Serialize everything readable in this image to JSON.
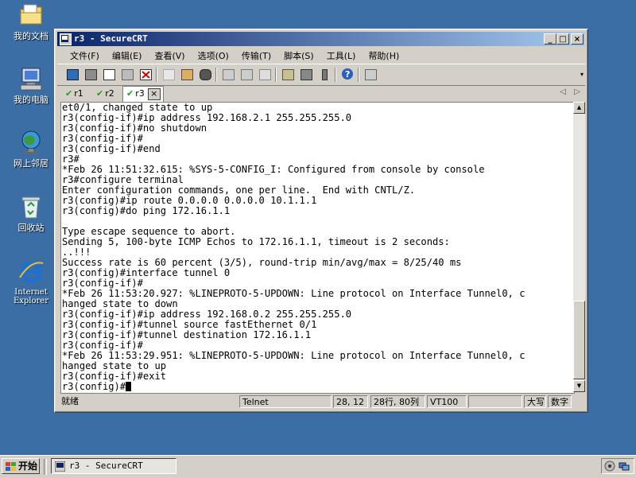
{
  "desktop": {
    "icons": [
      {
        "label": "我的文档"
      },
      {
        "label": "我的电脑"
      },
      {
        "label": "网上邻居"
      },
      {
        "label": "回收站"
      },
      {
        "label": "Internet Explorer"
      }
    ]
  },
  "window": {
    "title": "r3 - SecureCRT",
    "controls": {
      "minimize": "_",
      "maximize": "□",
      "close": "×"
    }
  },
  "menubar": {
    "items": [
      "文件(F)",
      "编辑(E)",
      "查看(V)",
      "选项(O)",
      "传输(T)",
      "脚本(S)",
      "工具(L)",
      "帮助(H)"
    ]
  },
  "tabs": {
    "items": [
      {
        "label": "r1"
      },
      {
        "label": "r2"
      },
      {
        "label": "r3"
      }
    ],
    "close_glyph": "×",
    "nav_left": "◁",
    "nav_right": "▷"
  },
  "terminal": {
    "lines": [
      "et0/1, changed state to up",
      "r3(config-if)#ip address 192.168.2.1 255.255.255.0",
      "r3(config-if)#no shutdown",
      "r3(config-if)#",
      "r3(config-if)#end",
      "r3#",
      "*Feb 26 11:51:32.615: %SYS-5-CONFIG_I: Configured from console by console",
      "r3#configure terminal",
      "Enter configuration commands, one per line.  End with CNTL/Z.",
      "r3(config)#ip route 0.0.0.0 0.0.0.0 10.1.1.1",
      "r3(config)#do ping 172.16.1.1",
      "",
      "Type escape sequence to abort.",
      "Sending 5, 100-byte ICMP Echos to 172.16.1.1, timeout is 2 seconds:",
      "..!!!",
      "Success rate is 60 percent (3/5), round-trip min/avg/max = 8/25/40 ms",
      "r3(config)#interface tunnel 0",
      "r3(config-if)#",
      "*Feb 26 11:53:20.927: %LINEPROTO-5-UPDOWN: Line protocol on Interface Tunnel0, c",
      "hanged state to down",
      "r3(config-if)#ip address 192.168.0.2 255.255.255.0",
      "r3(config-if)#tunnel source fastEthernet 0/1",
      "r3(config-if)#tunnel destination 172.16.1.1",
      "r3(config-if)#",
      "*Feb 26 11:53:29.951: %LINEPROTO-5-UPDOWN: Line protocol on Interface Tunnel0, c",
      "hanged state to up",
      "r3(config-if)#exit"
    ],
    "prompt": "r3(config)#"
  },
  "statusbar": {
    "status": "就绪",
    "protocol": "Telnet",
    "cursor_pos": "28, 12",
    "size": "28行, 80列",
    "emulation": "VT100",
    "blank": "",
    "caps": "大写",
    "num": "数字"
  },
  "taskbar": {
    "start_label": "开始",
    "task_label": "r3 - SecureCRT"
  },
  "colors": {
    "desktop": "#3a6ea5",
    "title_start": "#0a246a",
    "title_end": "#a6caf0",
    "face": "#d4d0c8",
    "check_green": "#2a9a2a"
  }
}
